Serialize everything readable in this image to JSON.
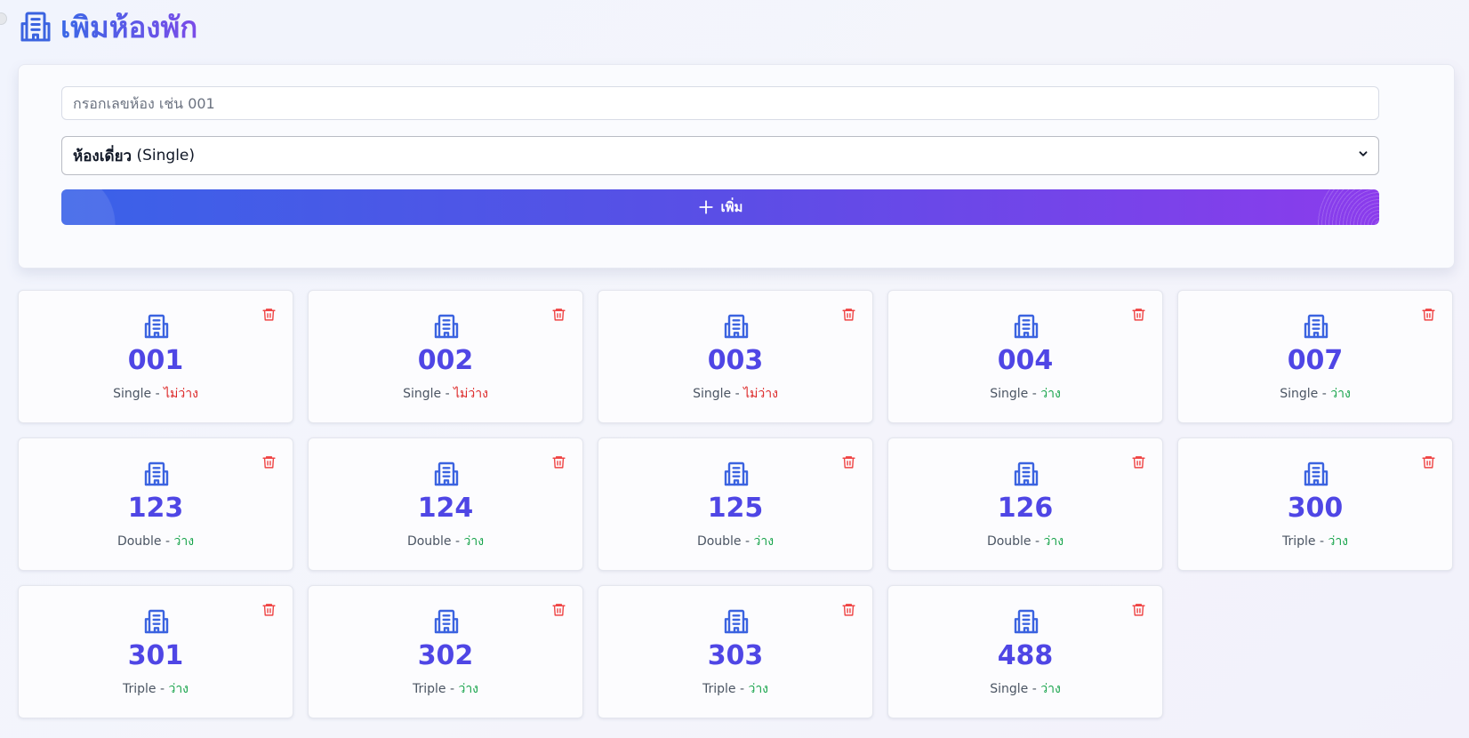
{
  "header": {
    "title": "เพิ่มห้องพัก",
    "icon": "building-icon"
  },
  "form": {
    "room_input": {
      "placeholder": "กรอกเลขห้อง เช่น 001",
      "value": ""
    },
    "room_type": {
      "selected_prefix": "ห้องเดี่ยว",
      "selected_suffix": " (Single)"
    },
    "add_button_label": "เพิ่ม"
  },
  "colors": {
    "accent": "#4f46e5",
    "icon": "#3b63e0",
    "busy": "#dc2626",
    "free": "#16a34a",
    "delete": "#ef4444"
  },
  "rooms": [
    {
      "number": "001",
      "type": "Single",
      "status": "ไม่ว่าง",
      "available": false
    },
    {
      "number": "002",
      "type": "Single",
      "status": "ไม่ว่าง",
      "available": false
    },
    {
      "number": "003",
      "type": "Single",
      "status": "ไม่ว่าง",
      "available": false
    },
    {
      "number": "004",
      "type": "Single",
      "status": "ว่าง",
      "available": true
    },
    {
      "number": "007",
      "type": "Single",
      "status": "ว่าง",
      "available": true
    },
    {
      "number": "123",
      "type": "Double",
      "status": "ว่าง",
      "available": true
    },
    {
      "number": "124",
      "type": "Double",
      "status": "ว่าง",
      "available": true
    },
    {
      "number": "125",
      "type": "Double",
      "status": "ว่าง",
      "available": true
    },
    {
      "number": "126",
      "type": "Double",
      "status": "ว่าง",
      "available": true
    },
    {
      "number": "300",
      "type": "Triple",
      "status": "ว่าง",
      "available": true
    },
    {
      "number": "301",
      "type": "Triple",
      "status": "ว่าง",
      "available": true
    },
    {
      "number": "302",
      "type": "Triple",
      "status": "ว่าง",
      "available": true
    },
    {
      "number": "303",
      "type": "Triple",
      "status": "ว่าง",
      "available": true
    },
    {
      "number": "488",
      "type": "Single",
      "status": "ว่าง",
      "available": true
    }
  ]
}
